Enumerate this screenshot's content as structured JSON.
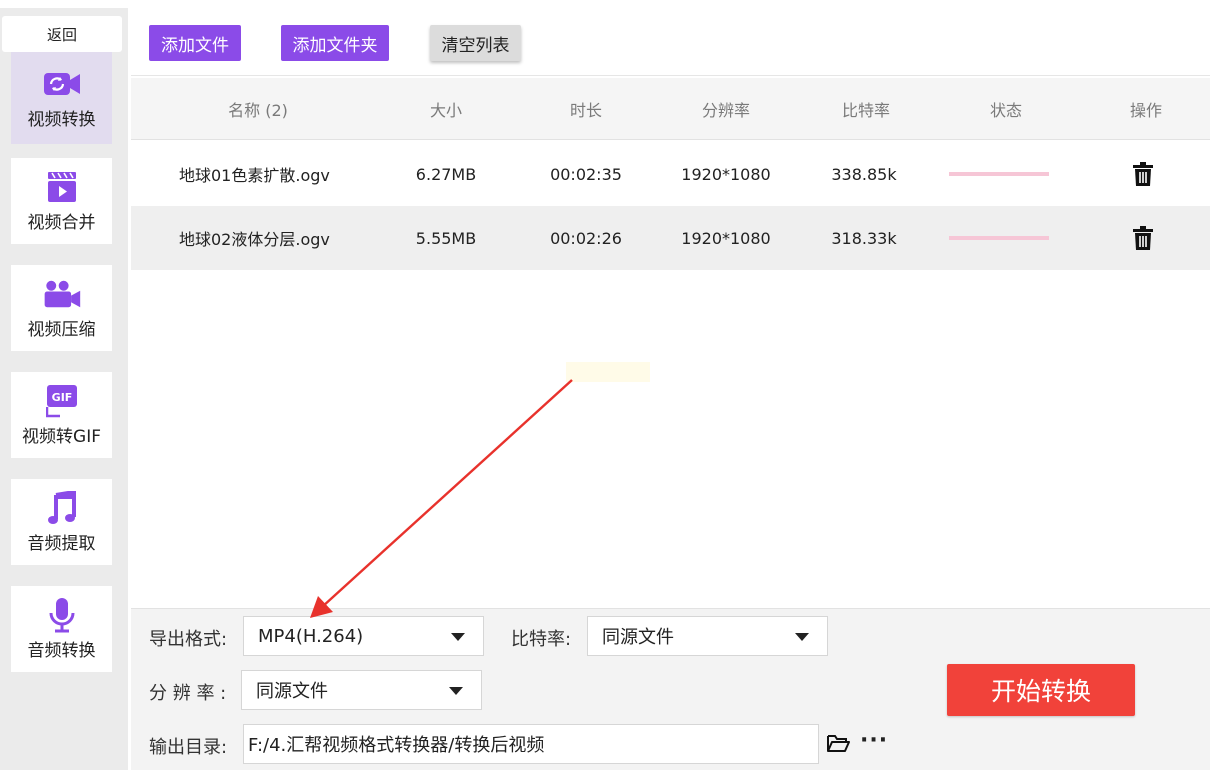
{
  "sidebar": {
    "back_label": "返回",
    "items": [
      {
        "label": "视频转换",
        "icon": "video-convert-icon",
        "active": true
      },
      {
        "label": "视频合并",
        "icon": "video-merge-icon",
        "active": false
      },
      {
        "label": "视频压缩",
        "icon": "video-compress-icon",
        "active": false
      },
      {
        "label": "视频转GIF",
        "icon": "gif-icon",
        "active": false
      },
      {
        "label": "音频提取",
        "icon": "music-note-icon",
        "active": false
      },
      {
        "label": "音频转换",
        "icon": "microphone-icon",
        "active": false
      }
    ]
  },
  "toolbar": {
    "add_file": "添加文件",
    "add_folder": "添加文件夹",
    "clear_list": "清空列表"
  },
  "table": {
    "headers": [
      "名称 (2)",
      "大小",
      "时长",
      "分辨率",
      "比特率",
      "状态",
      "操作"
    ],
    "rows": [
      {
        "name": "地球01色素扩散.ogv",
        "size": "6.27MB",
        "duration": "00:02:35",
        "resolution": "1920*1080",
        "bitrate": "338.85k"
      },
      {
        "name": "地球02液体分层.ogv",
        "size": "5.55MB",
        "duration": "00:02:26",
        "resolution": "1920*1080",
        "bitrate": "318.33k"
      }
    ]
  },
  "settings": {
    "format_label": "导出格式:",
    "format_value": "MP4(H.264)",
    "bitrate_label": "比特率:",
    "bitrate_value": "同源文件",
    "resolution_label": "分 辨 率 :",
    "resolution_value": "同源文件",
    "output_label": "输出目录:",
    "output_path": "F:/4.汇帮视频格式转换器/转换后视频",
    "more_label": "···",
    "start_label": "开始转换"
  },
  "colors": {
    "accent_purple": "#8b4be8",
    "start_red": "#f1423a",
    "status_pink": "#f6c6d6",
    "annotation_arrow": "#e8322c"
  }
}
